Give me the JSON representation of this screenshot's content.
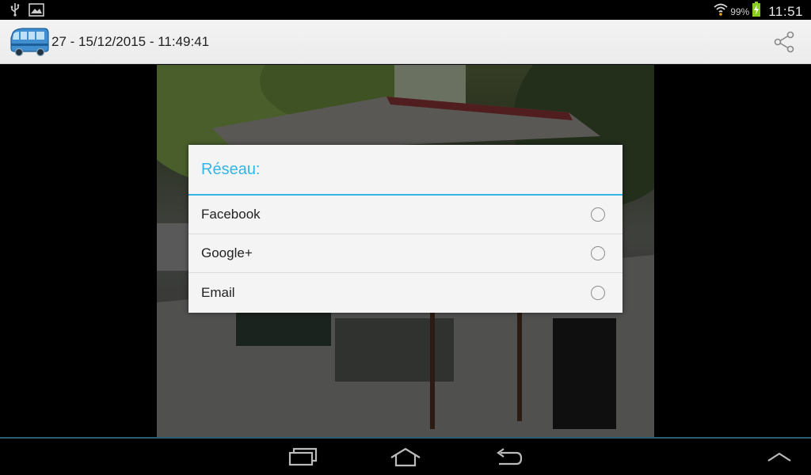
{
  "status_bar": {
    "left_icons": [
      "usb-icon",
      "image-notification-icon"
    ],
    "right_icons": [
      "wifi-icon",
      "battery-charging-icon"
    ],
    "battery_percent": "99%",
    "time": "11:51"
  },
  "action_bar": {
    "app_icon": "bus-icon",
    "title": "27 - 15/12/2015 - 11:49:41",
    "share_icon": "share-icon"
  },
  "dialog": {
    "title": "Réseau:",
    "options": [
      {
        "label": "Facebook",
        "selected": false
      },
      {
        "label": "Google+",
        "selected": false
      },
      {
        "label": "Email",
        "selected": false
      }
    ]
  },
  "nav_bar": {
    "buttons": [
      "recent-apps-icon",
      "home-icon",
      "back-icon",
      "menu-up-icon"
    ]
  },
  "colors": {
    "accent": "#33b5e5",
    "dialog_bg": "#f4f4f4",
    "action_bar_bg": "#efefef"
  }
}
